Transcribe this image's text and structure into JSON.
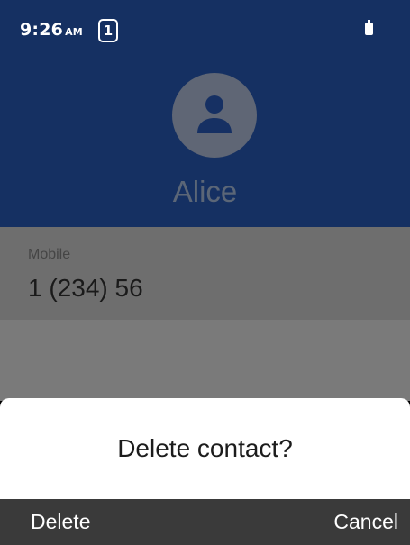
{
  "status_bar": {
    "time": "9:26",
    "ampm": "AM",
    "notification_count": "1",
    "battery_icon": "battery-icon"
  },
  "contact": {
    "avatar_icon": "person-icon",
    "name": "Alice"
  },
  "details": {
    "label": "Mobile",
    "value": "1 (234) 56"
  },
  "dialog": {
    "title": "Delete contact?"
  },
  "softkeys": {
    "left": "Delete",
    "right": "Cancel"
  },
  "colors": {
    "header_bg": "#153062",
    "softkey_bar": "#3a3a3a",
    "dialog_bg": "#ffffff"
  }
}
